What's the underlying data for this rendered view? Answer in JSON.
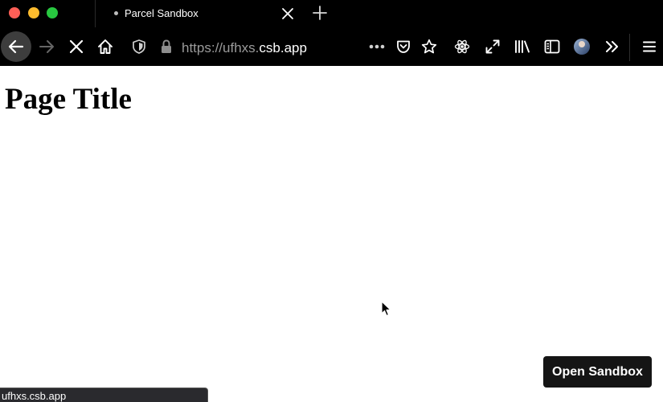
{
  "tab": {
    "title": "Parcel Sandbox"
  },
  "address_bar": {
    "scheme_prefix": "https://ufhxs.",
    "host": "csb.app"
  },
  "toolbar_icons": [
    "back-icon",
    "forward-icon",
    "stop-icon",
    "home-icon",
    "shield-icon",
    "lock-icon",
    "more-icon",
    "pocket-icon",
    "star-icon",
    "react-devtools-icon",
    "expand-icon",
    "library-icon",
    "sidebar-icon",
    "avatar",
    "overflow-icon",
    "menu-icon"
  ],
  "page": {
    "title": "Page Title",
    "open_sandbox_label": "Open Sandbox"
  },
  "status": {
    "url": "ufhxs.csb.app"
  },
  "colors": {
    "chrome_bg": "#000000",
    "traffic_close": "#ff5f57",
    "traffic_min": "#febc2e",
    "traffic_max": "#28c840",
    "button_bg": "#151515"
  }
}
